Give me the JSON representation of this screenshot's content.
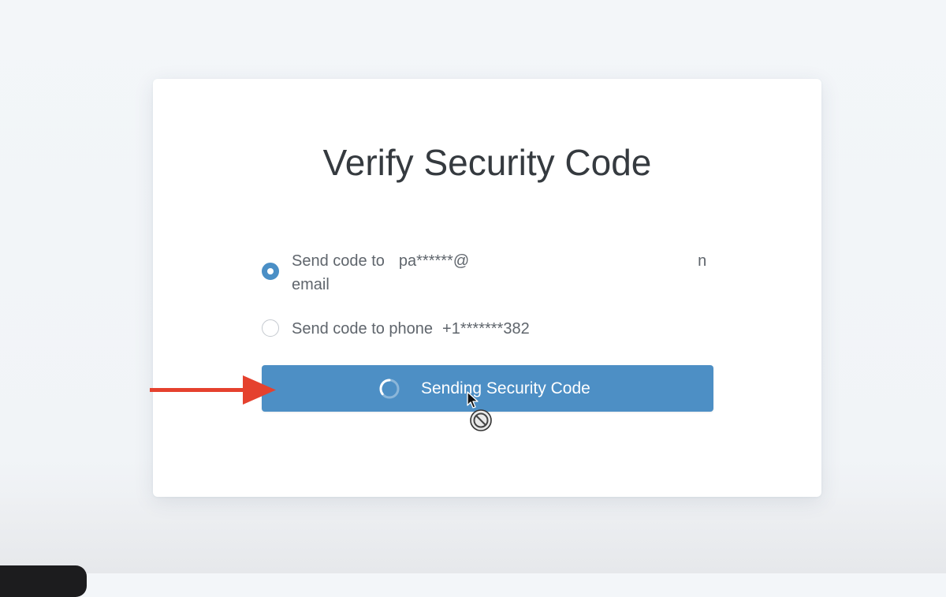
{
  "dialog": {
    "title": "Verify Security Code"
  },
  "options": [
    {
      "label_line1": "Send code to",
      "masked_value": "pa******@",
      "masked_tail": "n",
      "label_line2": "email",
      "selected": true
    },
    {
      "label": "Send code to phone",
      "masked_value": "+1*******382",
      "selected": false
    }
  ],
  "button": {
    "label": "Sending Security Code",
    "state": "loading"
  },
  "colors": {
    "accent": "#4d8fc5",
    "annotation_arrow": "#e5412e",
    "title_text": "#353a3f",
    "body_text": "#5f656c"
  },
  "icons": {
    "spinner": "loading-spinner-icon",
    "arrow": "red-arrow-annotation-icon",
    "cursor": "mouse-pointer-icon",
    "not_allowed": "not-allowed-cursor-icon"
  }
}
